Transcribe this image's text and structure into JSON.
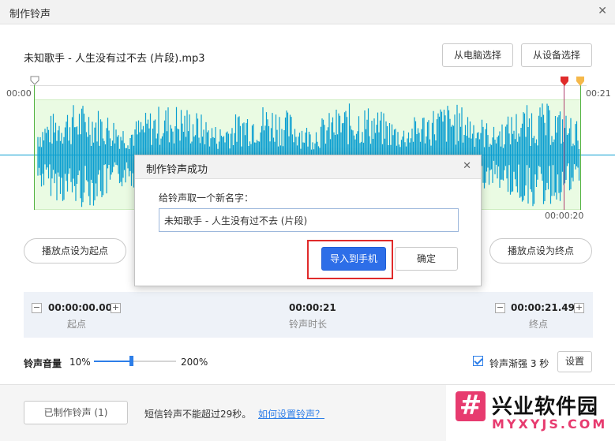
{
  "window": {
    "title": "制作铃声",
    "close_icon": "close-icon"
  },
  "file": {
    "name": "未知歌手 - 人生没有过不去 (片段).mp3"
  },
  "source_buttons": {
    "from_pc": "从电脑选择",
    "from_device": "从设备选择"
  },
  "timeline": {
    "start_label": "00:00",
    "end_label": "00:21",
    "end_marker_label": "00:00:20"
  },
  "colors": {
    "wave": "#0a9fd1",
    "wave_bg": "#eafbe3",
    "accent": "#2d6ee8",
    "highlight": "#e02b2b",
    "start_marker": "#52b240",
    "end_marker_red": "#e02b2b",
    "end_marker_orange": "#f5b84a"
  },
  "actions": {
    "set_start": "播放点设为起点",
    "set_end": "播放点设为终点"
  },
  "range": {
    "start_value": "00:00:00.000",
    "start_label": "起点",
    "duration_value": "00:00:21",
    "duration_label": "铃声时长",
    "end_value": "00:00:21.498",
    "end_label": "终点",
    "minus": "−",
    "plus": "+"
  },
  "volume": {
    "label": "铃声音量",
    "min": "10%",
    "max": "200%",
    "level_fraction": 0.45
  },
  "fade": {
    "checked": true,
    "label": "铃声渐强 3 秒",
    "settings_button": "设置"
  },
  "footer": {
    "made_button": "已制作铃声 (1)",
    "sms_note": "短信铃声不能超过29秒。",
    "howto_link": "如何设置铃声？"
  },
  "watermark": {
    "name": "兴业软件园",
    "domain": "MYXYJS.COM"
  },
  "dialog": {
    "title": "制作铃声成功",
    "prompt": "给铃声取一个新名字：",
    "name_value": "未知歌手 - 人生没有过不去 (片段)",
    "import_button": "导入到手机",
    "ok_button": "确定"
  }
}
